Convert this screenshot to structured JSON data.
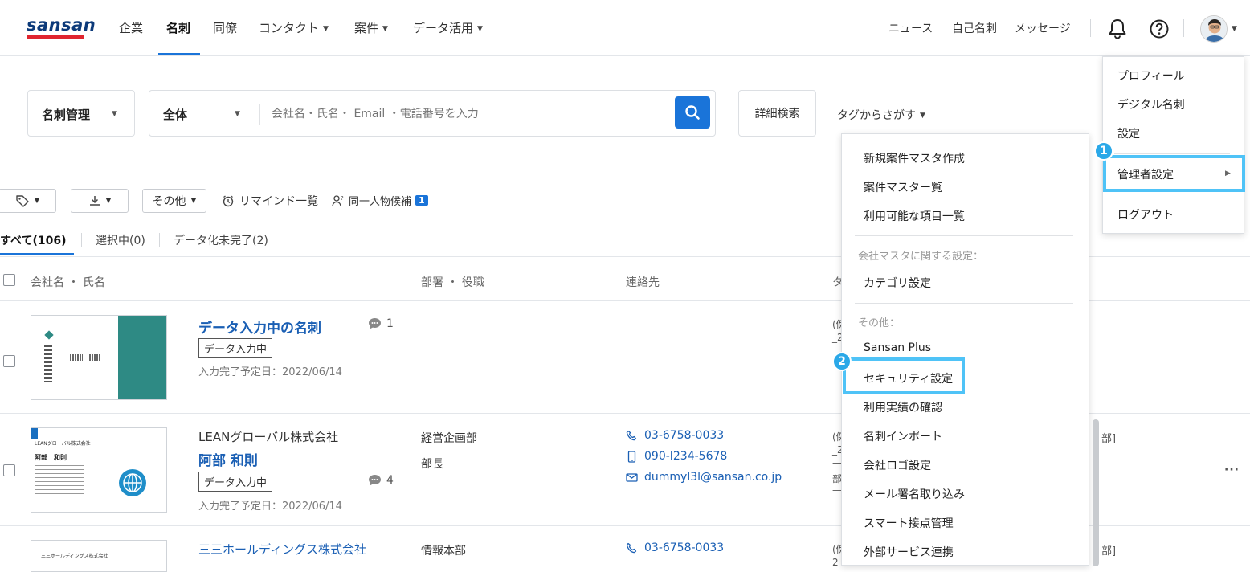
{
  "header": {
    "logo": "sansan",
    "nav": [
      {
        "label": "企業"
      },
      {
        "label": "名刺"
      },
      {
        "label": "同僚"
      },
      {
        "label": "コンタクト"
      },
      {
        "label": "案件"
      },
      {
        "label": "データ活用"
      }
    ],
    "utils": {
      "news": "ニュース",
      "my_card": "自己名刺",
      "message": "メッセージ"
    }
  },
  "search": {
    "mode": "名刺管理",
    "scope": "全体",
    "placeholder": "会社名・氏名・ Email ・電話番号を入力",
    "advanced": "詳細検索",
    "tag_search": "タグからさがす"
  },
  "toolbar": {
    "other": "その他",
    "remind": "リマインド一覧",
    "same_person": "同一人物候補",
    "same_person_count": "1"
  },
  "tabs": {
    "all": "すべて(106)",
    "selected": "選択中(0)",
    "incomplete": "データ化未完了(2)"
  },
  "columns": {
    "company_name": "会社名 ・ 氏名",
    "dept": "部署 ・ 役職",
    "contact": "連絡先",
    "tag": "タ"
  },
  "rows": [
    {
      "title": "データ入力中の名刺",
      "status": "データ入力中",
      "due": "入力完了予定日：2022/06/14",
      "comments": "1",
      "tag_glyph": "(例",
      "tag_glyph2": "_2"
    },
    {
      "company": "LEANグローバル株式会社",
      "name": "阿部 和則",
      "status": "データ入力中",
      "due": "入力完了予定日：2022/06/14",
      "comments": "4",
      "dept": "経営企画部",
      "role": "部長",
      "phone": "03-6758-0033",
      "mobile": "090-I234-5678",
      "email": "dummyl3l@sansan.co.jp",
      "tag_glyph": "(例",
      "tag_glyph2": "_2",
      "tag_glyph3": "—",
      "tag_glyph4": "部",
      "tag_glyph5": "—",
      "tag_right": "部]",
      "card_company": "LEANグローバル株式会社",
      "card_name": "阿部　和則"
    },
    {
      "company": "三三ホールディングス株式会社",
      "dept": "情報本部",
      "phone": "03-6758-0033",
      "tag_glyph": "(例",
      "tag_glyph2": "2",
      "tag_right": "部]",
      "card_company": "三三ホールディングス株式会社"
    }
  ],
  "admin_menu": {
    "items": [
      "新規案件マスタ作成",
      "案件マスター覧",
      "利用可能な項目一覧"
    ],
    "section_company": "会社マスタに関する設定：",
    "category": "カテゴリ設定",
    "section_other": "その他：",
    "other_items": [
      "Sansan Plus",
      "セキュリティ設定",
      "利用実績の確認",
      "名刺インポート",
      "会社ロゴ設定",
      "メール署名取り込み",
      "スマート接点管理",
      "外部サービス連携"
    ]
  },
  "user_menu": {
    "items": [
      "プロフィール",
      "デジタル名刺",
      "設定"
    ],
    "admin": "管理者設定",
    "logout": "ログアウト"
  },
  "callouts": {
    "one": "1",
    "two": "2"
  },
  "colors": {
    "accent": "#1a74d9",
    "highlight": "#4fc3f7",
    "logo": "#0c3a7a"
  }
}
